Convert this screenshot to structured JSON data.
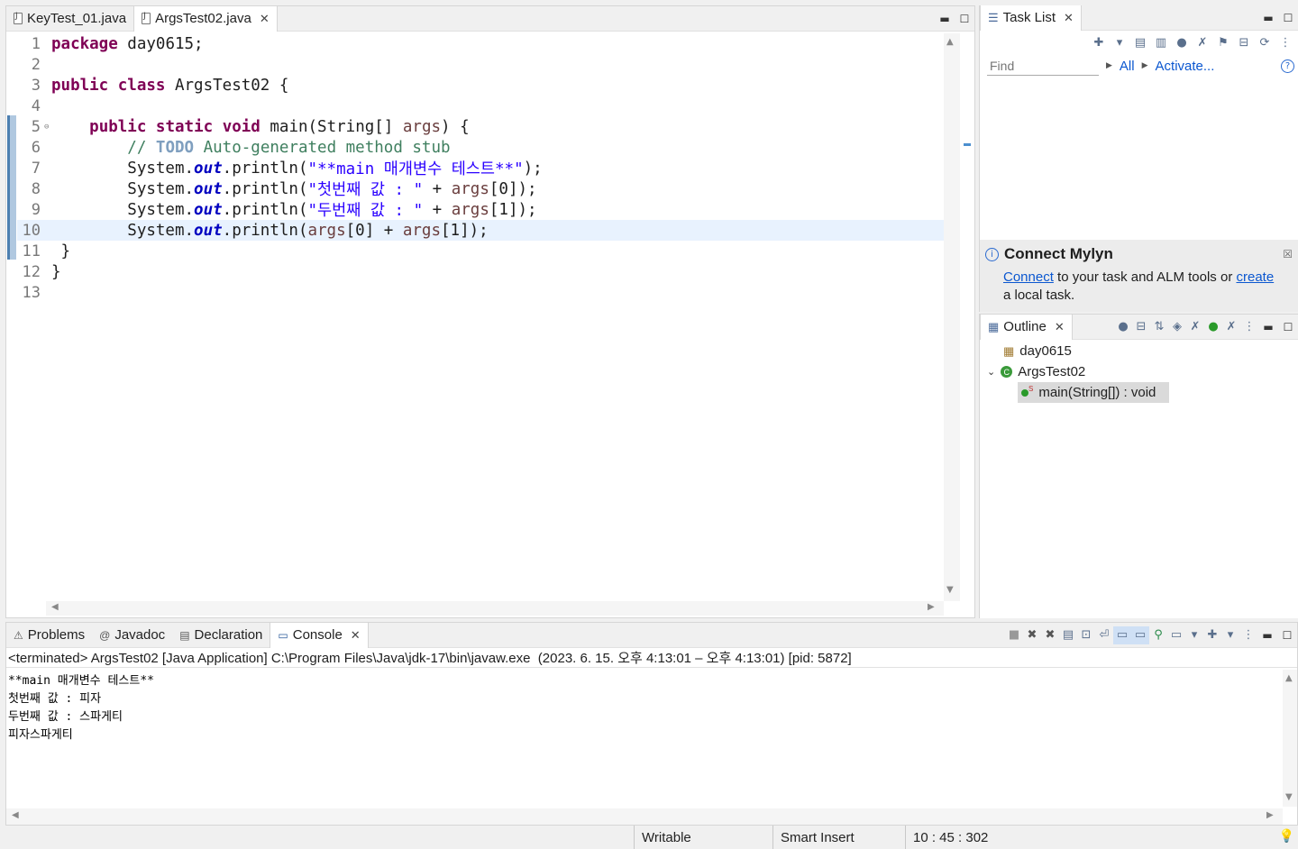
{
  "editor": {
    "tabs": [
      {
        "label": "KeyTest_01.java"
      },
      {
        "label": "ArgsTest02.java"
      }
    ],
    "lines": [
      {
        "n": "1",
        "parts": [
          [
            "kw",
            "package"
          ],
          [
            "t",
            " day0615;"
          ]
        ]
      },
      {
        "n": "2",
        "parts": []
      },
      {
        "n": "3",
        "parts": [
          [
            "kw",
            "public"
          ],
          [
            "t",
            " "
          ],
          [
            "kw",
            "class"
          ],
          [
            "t",
            " ArgsTest02 {"
          ]
        ]
      },
      {
        "n": "4",
        "parts": []
      },
      {
        "n": "5",
        "parts": [
          [
            "t",
            "    "
          ],
          [
            "kw",
            "public"
          ],
          [
            "t",
            " "
          ],
          [
            "kw",
            "static"
          ],
          [
            "t",
            " "
          ],
          [
            "kw",
            "void"
          ],
          [
            "t",
            " main(String[] "
          ],
          [
            "var",
            "args"
          ],
          [
            "t",
            ") {"
          ]
        ]
      },
      {
        "n": "6",
        "parts": [
          [
            "t",
            "        "
          ],
          [
            "cmt",
            "// "
          ],
          [
            "todo",
            "TODO"
          ],
          [
            "cmt",
            " Auto-generated method stub"
          ]
        ]
      },
      {
        "n": "7",
        "parts": [
          [
            "t",
            "        System."
          ],
          [
            "fld",
            "out"
          ],
          [
            "t",
            ".println("
          ],
          [
            "str",
            "\"**main 매개변수 테스트**\""
          ],
          [
            "t",
            ");"
          ]
        ]
      },
      {
        "n": "8",
        "parts": [
          [
            "t",
            "        System."
          ],
          [
            "fld",
            "out"
          ],
          [
            "t",
            ".println("
          ],
          [
            "str",
            "\"첫번째 값 : \""
          ],
          [
            "t",
            " + "
          ],
          [
            "var",
            "args"
          ],
          [
            "t",
            "[0]);"
          ]
        ]
      },
      {
        "n": "9",
        "parts": [
          [
            "t",
            "        System."
          ],
          [
            "fld",
            "out"
          ],
          [
            "t",
            ".println("
          ],
          [
            "str",
            "\"두번째 값 : \""
          ],
          [
            "t",
            " + "
          ],
          [
            "var",
            "args"
          ],
          [
            "t",
            "[1]);"
          ]
        ]
      },
      {
        "n": "10",
        "parts": [
          [
            "t",
            "        System."
          ],
          [
            "fld",
            "out"
          ],
          [
            "t",
            ".println("
          ],
          [
            "var",
            "args"
          ],
          [
            "t",
            "[0] + "
          ],
          [
            "var",
            "args"
          ],
          [
            "t",
            "[1]);"
          ]
        ]
      },
      {
        "n": "11",
        "parts": [
          [
            "t",
            " }"
          ]
        ]
      },
      {
        "n": "12",
        "parts": [
          [
            "t",
            "}"
          ]
        ]
      },
      {
        "n": "13",
        "parts": []
      }
    ]
  },
  "tasklist": {
    "title": "Task List",
    "find_placeholder": "Find",
    "all_label": "All",
    "activate_label": "Activate..."
  },
  "mylyn": {
    "title": "Connect Mylyn",
    "connect_link": "Connect",
    "text_mid": " to your task and ALM tools or ",
    "create_link": "create",
    "text_end": "a local task."
  },
  "outline": {
    "title": "Outline",
    "items": [
      {
        "label": "day0615"
      },
      {
        "label": "ArgsTest02"
      },
      {
        "label": "main(String[]) : void"
      }
    ]
  },
  "console": {
    "tabs": [
      {
        "label": "Problems"
      },
      {
        "label": "Javadoc"
      },
      {
        "label": "Declaration"
      },
      {
        "label": "Console"
      }
    ],
    "header": "<terminated> ArgsTest02 [Java Application] C:\\Program Files\\Java\\jdk-17\\bin\\javaw.exe  (2023. 6. 15. 오후 4:13:01 – 오후 4:13:01) [pid: 5872]",
    "output": [
      "**main 매개변수 테스트**",
      "첫번째 값 : 피자",
      "두번째 값 : 스파게티",
      "피자스파게티"
    ]
  },
  "status": {
    "writable": "Writable",
    "insert_mode": "Smart Insert",
    "position": "10 : 45 : 302"
  }
}
